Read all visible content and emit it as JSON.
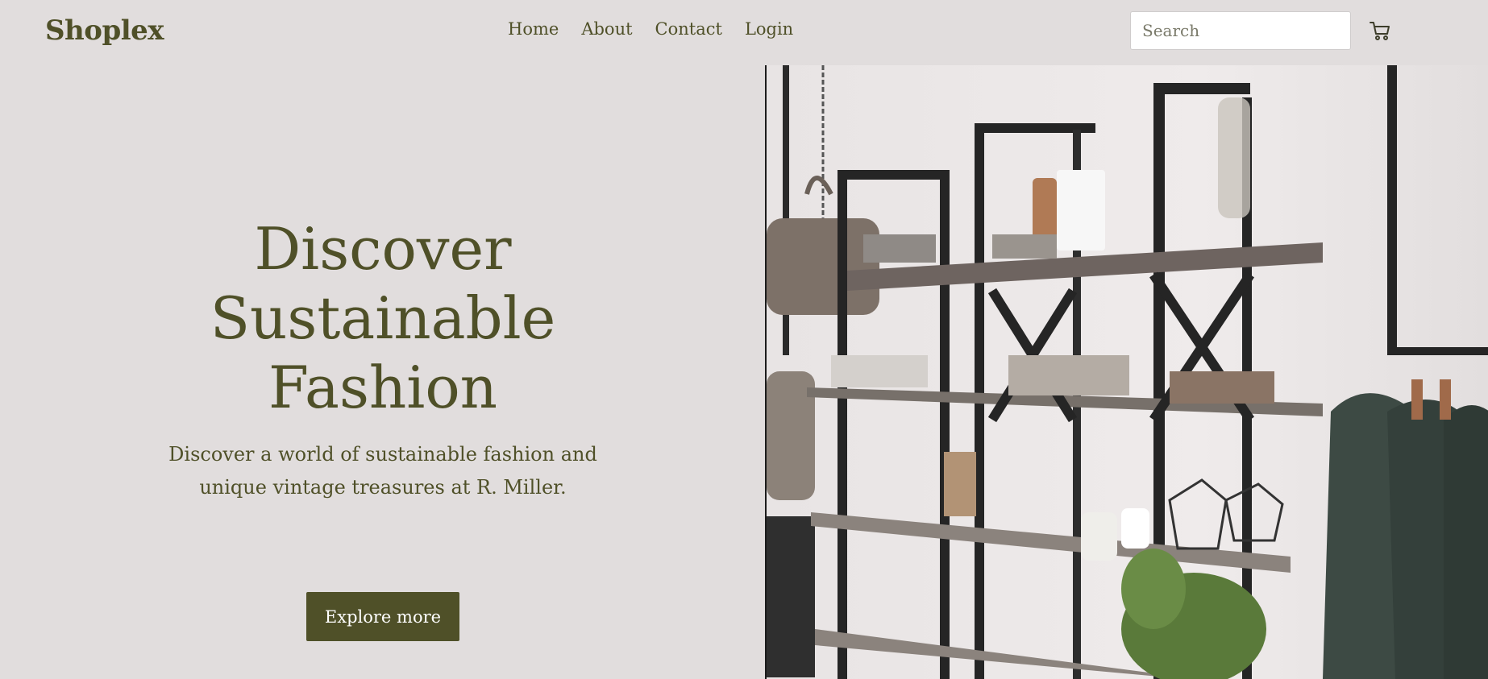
{
  "brand": {
    "name": "Shoplex"
  },
  "nav": {
    "items": [
      {
        "label": "Home"
      },
      {
        "label": "About"
      },
      {
        "label": "Contact"
      },
      {
        "label": "Login"
      }
    ]
  },
  "search": {
    "placeholder": "Search",
    "value": ""
  },
  "cart": {
    "icon": "shopping-cart-icon"
  },
  "hero": {
    "title_lines": [
      "Discover",
      "Sustainable",
      "Fashion"
    ],
    "subtitle": "Discover a world of sustainable fashion and unique vintage treasures at R. Miller.",
    "cta_label": "Explore more"
  },
  "colors": {
    "brand": "#4f5028",
    "background": "#e1dddd",
    "button_text": "#ffffff"
  }
}
